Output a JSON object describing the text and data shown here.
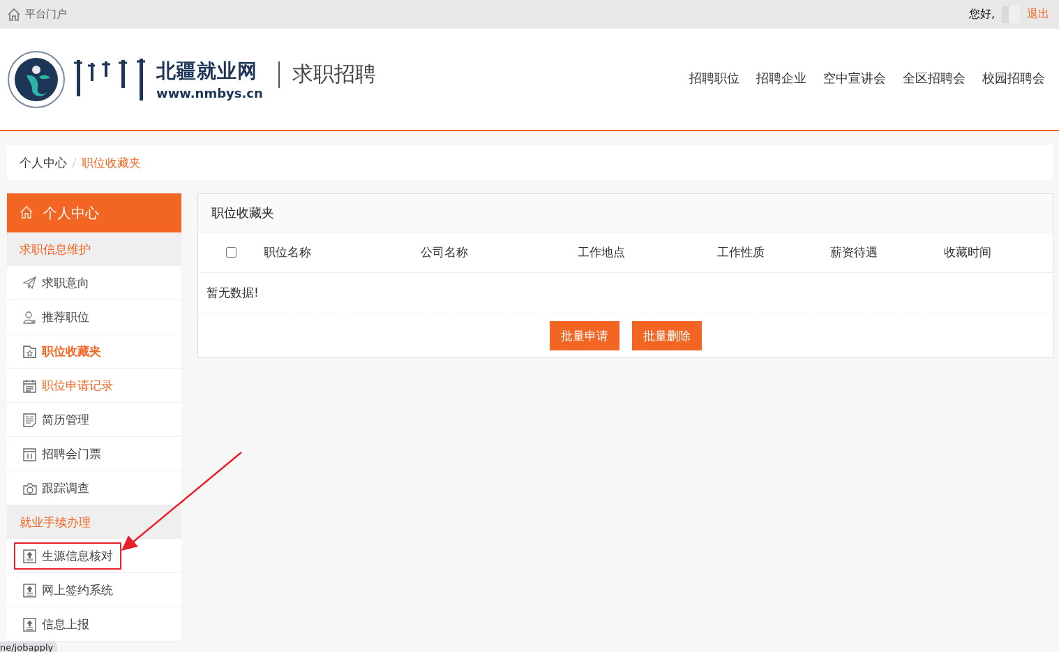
{
  "top_bar": {
    "portal_link": "平台门户",
    "greeting": "您好,",
    "logout": "退出"
  },
  "header": {
    "logo_site_name": "北疆就业网",
    "logo_url": "www.nmbys.cn",
    "section_title": "求职招聘",
    "nav": [
      {
        "label": "招聘职位"
      },
      {
        "label": "招聘企业"
      },
      {
        "label": "空中宣讲会"
      },
      {
        "label": "全区招聘会"
      },
      {
        "label": "校园招聘会"
      }
    ]
  },
  "breadcrumb": [
    {
      "label": "个人中心",
      "current": false
    },
    {
      "label": "职位收藏夹",
      "current": true
    }
  ],
  "sidebar": {
    "title": "个人中心",
    "groups": [
      {
        "label": "求职信息维护",
        "items": [
          {
            "label": "求职意向",
            "selected": false,
            "hovered": false,
            "highlighted": false
          },
          {
            "label": "推荐职位",
            "selected": false,
            "hovered": false,
            "highlighted": false
          },
          {
            "label": "职位收藏夹",
            "selected": true,
            "hovered": false,
            "highlighted": false
          },
          {
            "label": "职位申请记录",
            "selected": false,
            "hovered": true,
            "highlighted": false
          },
          {
            "label": "简历管理",
            "selected": false,
            "hovered": false,
            "highlighted": false
          },
          {
            "label": "招聘会门票",
            "selected": false,
            "hovered": false,
            "highlighted": false
          },
          {
            "label": "跟踪调查",
            "selected": false,
            "hovered": false,
            "highlighted": false
          }
        ]
      },
      {
        "label": "就业手续办理",
        "items": [
          {
            "label": "生源信息核对",
            "selected": false,
            "hovered": false,
            "highlighted": true
          },
          {
            "label": "网上签约系统",
            "selected": false,
            "hovered": false,
            "highlighted": false
          },
          {
            "label": "信息上报",
            "selected": false,
            "hovered": false,
            "highlighted": false
          }
        ]
      }
    ]
  },
  "panel": {
    "title": "职位收藏夹",
    "table": {
      "select_all_checked": false,
      "columns": [
        "职位名称",
        "公司名称",
        "工作地点",
        "工作性质",
        "薪资待遇",
        "收藏时间"
      ],
      "empty_text": "暂无数据!"
    },
    "buttons": [
      "批量申请",
      "批量删除"
    ]
  },
  "status_url": "ne/jobapply"
}
